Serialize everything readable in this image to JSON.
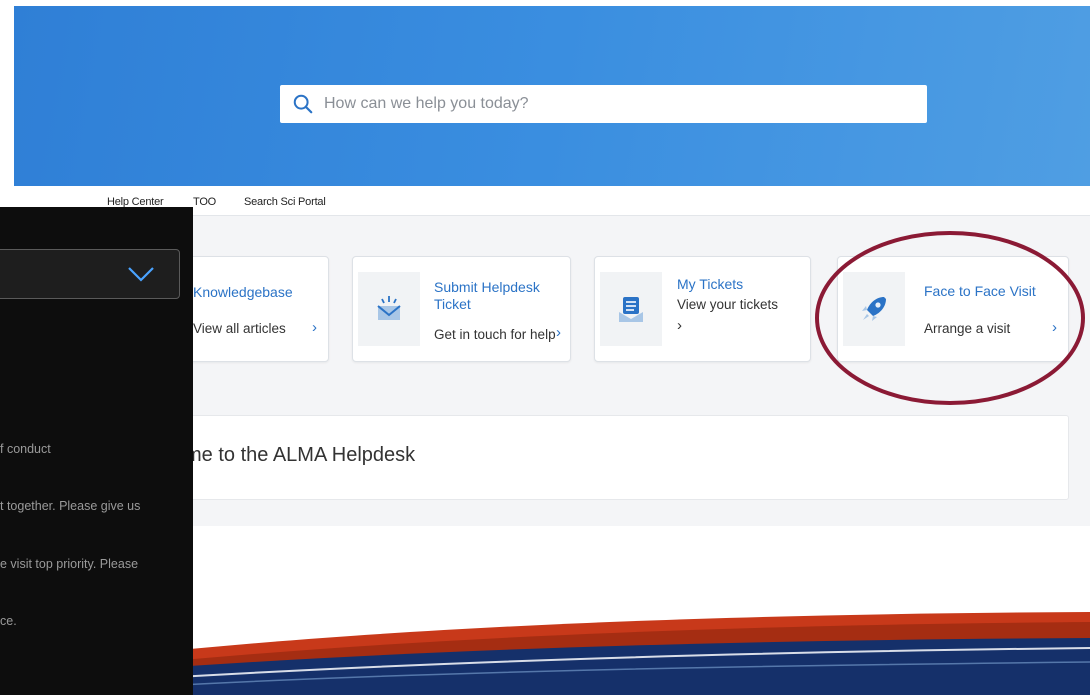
{
  "search": {
    "placeholder": "How can we help you today?"
  },
  "nav": {
    "items": [
      "Help Center",
      "TOO",
      "Search Sci Portal"
    ]
  },
  "cards": [
    {
      "title": "Knowledgebase",
      "desc": "View all articles",
      "chevron": "›",
      "icon": "book-icon"
    },
    {
      "title_line1": "Submit Helpdesk",
      "title_line2": "Ticket",
      "desc": "Get in touch for help",
      "chevron": "›",
      "icon": "envelope-sparkle-icon"
    },
    {
      "title": "My Tickets",
      "desc": "View your tickets",
      "chevron": "›",
      "icon": "inbox-list-icon"
    },
    {
      "title": "Face to Face Visit",
      "desc": "Arrange a visit",
      "chevron": "›",
      "icon": "rocket-icon"
    }
  ],
  "welcome": {
    "title": "me to the ALMA Helpdesk"
  },
  "dark_panel": {
    "lines": [
      "f conduct",
      "t together. Please give us",
      "e visit top priority. Please",
      "ce."
    ]
  },
  "colors": {
    "hero": "#3a8ee0",
    "accent": "#2b73c6",
    "annotation": "#8b1a35",
    "panel": "#0d0d0d"
  }
}
